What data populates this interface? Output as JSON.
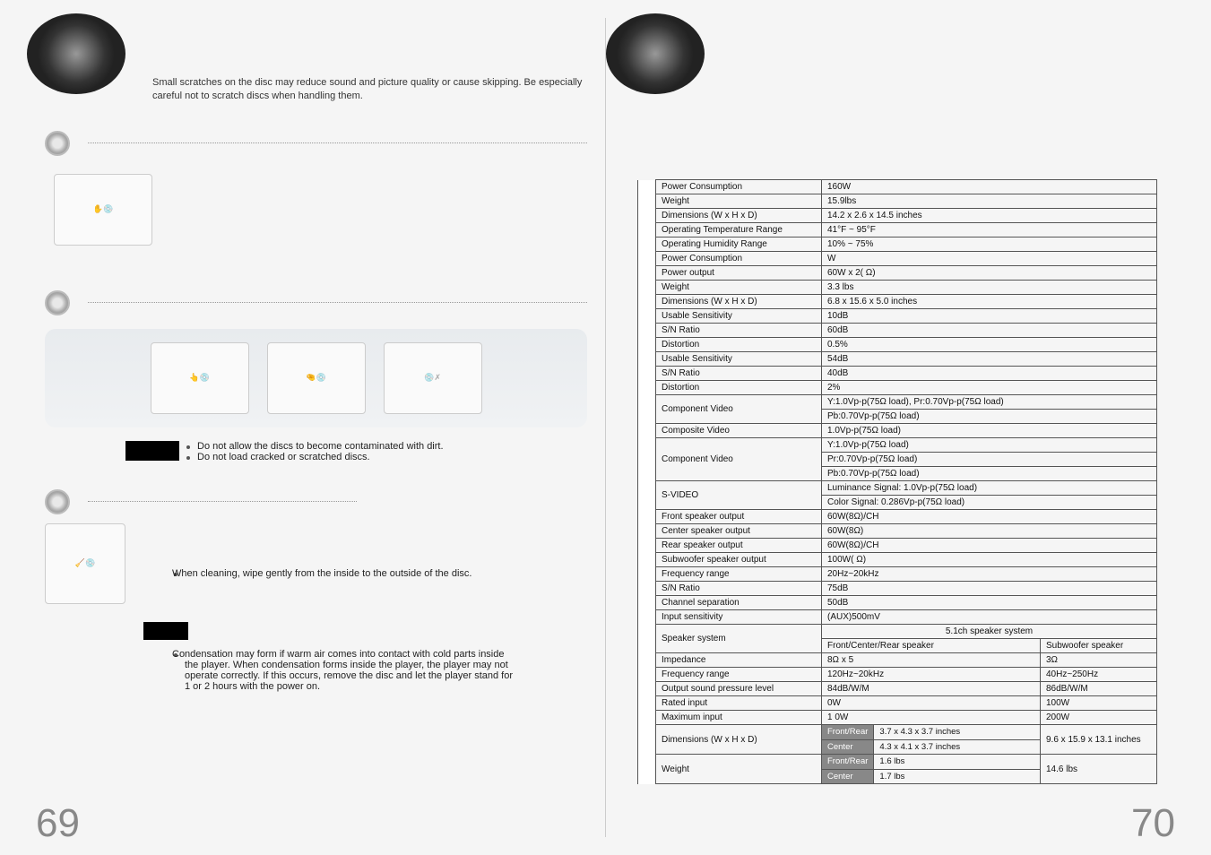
{
  "left": {
    "intro": "Small scratches on the disc may reduce sound and picture quality or cause skipping. Be especially careful not to scratch discs when handling them.",
    "dirt_bullets": [
      "Do not allow the discs to become contaminated with dirt.",
      "Do not load cracked or scratched discs."
    ],
    "cleaning": "When cleaning, wipe gently from the inside to the outside of the disc.",
    "condensation": "Condensation may form if warm air comes into contact with cold parts inside the player. When condensation forms inside the player, the player may not operate correctly. If this occurs, remove the disc and let the player stand for 1 or 2 hours with the power on.",
    "page_number": "69"
  },
  "right": {
    "page_number": "70",
    "rows": [
      {
        "k": "Power Consumption",
        "v": "160W"
      },
      {
        "k": "Weight",
        "v": "15.9lbs"
      },
      {
        "k": "Dimensions (W x H x D)",
        "v": "14.2 x 2.6 x 14.5 inches"
      },
      {
        "k": "Operating Temperature Range",
        "v": "41°F ~ 95°F"
      },
      {
        "k": "Operating Humidity Range",
        "v": "10% ~ 75%"
      },
      {
        "k": "Power Consumption",
        "v": "  W"
      },
      {
        "k": "Power output",
        "v": "60W x 2(  Ω)"
      },
      {
        "k": "Weight",
        "v": "3.3 lbs"
      },
      {
        "k": "Dimensions (W x H x D)",
        "v": "6.8 x 15.6 x 5.0 inches"
      },
      {
        "k": "Usable Sensitivity",
        "v": "10dB"
      },
      {
        "k": "S/N Ratio",
        "v": "60dB"
      },
      {
        "k": "Distortion",
        "v": "0.5%"
      },
      {
        "k": "Usable Sensitivity",
        "v": "54dB"
      },
      {
        "k": "S/N Ratio",
        "v": "40dB"
      },
      {
        "k": "Distortion",
        "v": "2%"
      }
    ],
    "component_video_1": {
      "k": "Component Video",
      "line1": "Y:1.0Vp-p(75Ω load), Pr:0.70Vp-p(75Ω load)",
      "line2": "Pb:0.70Vp-p(75Ω load)"
    },
    "composite_video": {
      "k": "Composite Video",
      "v": "1.0Vp-p(75Ω load)"
    },
    "component_video_2": {
      "k": "Component Video",
      "line1": "Y:1.0Vp-p(75Ω load)",
      "line2": "Pr:0.70Vp-p(75Ω load)",
      "line3": "Pb:0.70Vp-p(75Ω load)"
    },
    "svideo": {
      "k": "S-VIDEO",
      "line1": "Luminance Signal: 1.0Vp-p(75Ω load)",
      "line2": "Color Signal: 0.286Vp-p(75Ω load)"
    },
    "amp_rows": [
      {
        "k": "Front speaker output",
        "v": "60W(8Ω)/CH"
      },
      {
        "k": "Center speaker output",
        "v": "60W(8Ω)"
      },
      {
        "k": "Rear speaker output",
        "v": "60W(8Ω)/CH"
      },
      {
        "k": "Subwoofer speaker output",
        "v": "100W(  Ω)"
      },
      {
        "k": "Frequency range",
        "v": "20Hz~20kHz"
      },
      {
        "k": "S/N Ratio",
        "v": "75dB"
      },
      {
        "k": "Channel separation",
        "v": "50dB"
      },
      {
        "k": "Input sensitivity",
        "v": "(AUX)500mV"
      }
    ],
    "speaker_system": {
      "k": "Speaker system",
      "header": "5.1ch speaker system",
      "col1": "Front/Center/Rear speaker",
      "col2": "Subwoofer speaker"
    },
    "speaker_rows": [
      {
        "k": "Impedance",
        "c1": "8Ω x 5",
        "c2": "3Ω"
      },
      {
        "k": "Frequency range",
        "c1": "120Hz~20kHz",
        "c2": "40Hz~250Hz"
      },
      {
        "k": "Output sound pressure level",
        "c1": "84dB/W/M",
        "c2": "86dB/W/M"
      },
      {
        "k": "Rated input",
        "c1": "  0W",
        "c2": "100W"
      },
      {
        "k": "Maximum input",
        "c1": "1  0W",
        "c2": "200W"
      }
    ],
    "dimensions": {
      "k": "Dimensions  (W x H x D)",
      "front_rear_label": "Front/Rear",
      "front_rear_val": "3.7 x 4.3 x 3.7 inches",
      "center_label": "Center",
      "center_val": "4.3 x 4.1 x 3.7 inches",
      "sub": "9.6 x 15.9 x 13.1 inches"
    },
    "weight": {
      "k": "Weight",
      "front_rear_label": "Front/Rear",
      "front_rear_val": "1.6 lbs",
      "center_label": "Center",
      "center_val": "1.7 lbs",
      "sub": "14.6 lbs"
    }
  }
}
